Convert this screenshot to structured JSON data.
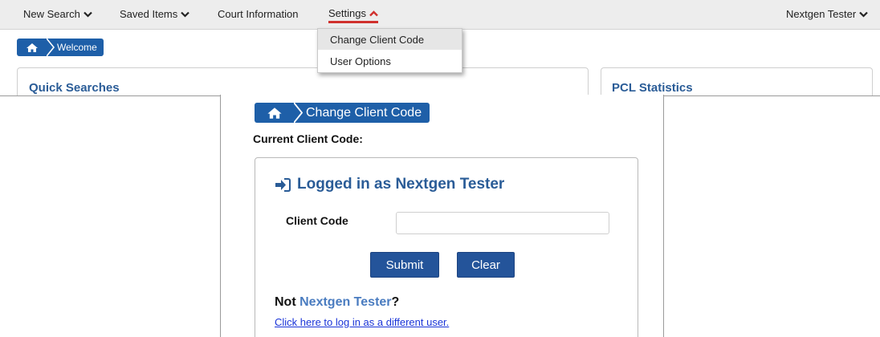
{
  "nav": {
    "new_search": "New Search",
    "saved_items": "Saved Items",
    "court_information": "Court Information",
    "settings": "Settings",
    "user_menu": "Nextgen Tester"
  },
  "settings_menu": {
    "items": [
      "Change Client Code",
      "User Options"
    ],
    "highlighted_index": 0
  },
  "background_page": {
    "breadcrumb": "Welcome",
    "quick_searches_title": "Quick Searches",
    "pcl_statistics_title": "PCL Statistics"
  },
  "change_client_code": {
    "breadcrumb": "Change Client Code",
    "current_label": "Current Client Code:",
    "logged_in_title": "Logged in as Nextgen Tester",
    "client_code_label": "Client Code",
    "client_code_value": "",
    "submit_label": "Submit",
    "clear_label": "Clear",
    "not_prefix": "Not ",
    "not_user": "Nextgen Tester",
    "not_suffix": "?",
    "different_user_link": "Click here to log in as a different user."
  },
  "colors": {
    "brand_blue": "#1e5fa8",
    "title_blue": "#2a5c97",
    "settings_accent": "#d0312d",
    "link_blue": "#1a34d8"
  },
  "icons": [
    "chevron-down-icon",
    "chevron-up-icon",
    "home-icon",
    "sign-in-icon"
  ]
}
